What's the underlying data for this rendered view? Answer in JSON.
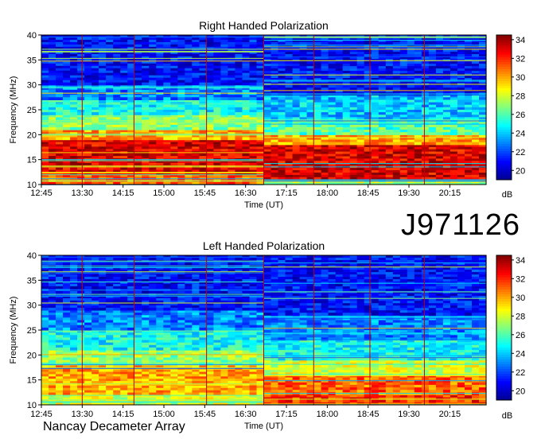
{
  "observatory": "Nancay Decameter Array",
  "observation_id": "J971126",
  "colors": {
    "colormap": [
      "#00008f",
      "#0000ff",
      "#0080ff",
      "#00ffff",
      "#80ff80",
      "#ffff00",
      "#ff8000",
      "#ff0000",
      "#800000"
    ],
    "marker_line": "#c00000"
  },
  "chart_data": [
    {
      "type": "heatmap",
      "title": "Right Handed Polarization",
      "xlabel": "Time (UT)",
      "ylabel": "Frequency (MHz)",
      "x_ticks": [
        "12:45",
        "13:30",
        "14:15",
        "15:00",
        "15:45",
        "16:30",
        "17:15",
        "18:00",
        "18:45",
        "19:30",
        "20:15"
      ],
      "y_ticks": [
        10,
        15,
        20,
        25,
        30,
        35,
        40
      ],
      "ylim": [
        10,
        40
      ],
      "xlim": [
        "12:45",
        "20:55"
      ],
      "colorbar": {
        "label": "dB",
        "ticks": [
          20,
          22,
          24,
          26,
          28,
          30,
          32,
          34
        ],
        "range": [
          19,
          34.5
        ]
      },
      "marker_times": [
        "13:30",
        "14:27",
        "15:47",
        "16:50",
        "17:45",
        "18:47",
        "19:47"
      ],
      "session_break": "16:50",
      "bands_before_break": [
        {
          "from": 10,
          "to": 12,
          "db": 31
        },
        {
          "from": 12,
          "to": 19,
          "db": 33
        },
        {
          "from": 19,
          "to": 21,
          "db": 30
        },
        {
          "from": 21,
          "to": 24,
          "db": 27
        },
        {
          "from": 24,
          "to": 27,
          "db": 25
        },
        {
          "from": 27,
          "to": 30,
          "db": 23
        },
        {
          "from": 30,
          "to": 40,
          "db": 21
        }
      ],
      "bands_after_break": [
        {
          "from": 10,
          "to": 11,
          "db": 28
        },
        {
          "from": 11,
          "to": 18,
          "db": 33
        },
        {
          "from": 18,
          "to": 20,
          "db": 30
        },
        {
          "from": 20,
          "to": 23,
          "db": 26
        },
        {
          "from": 23,
          "to": 28,
          "db": 24
        },
        {
          "from": 28,
          "to": 40,
          "db": 21
        }
      ]
    },
    {
      "type": "heatmap",
      "title": "Left Handed Polarization",
      "xlabel": "Time (UT)",
      "ylabel": "Frequency (MHz)",
      "x_ticks": [
        "12:45",
        "13:30",
        "14:15",
        "15:00",
        "15:45",
        "16:30",
        "17:15",
        "18:00",
        "18:45",
        "19:30",
        "20:15"
      ],
      "y_ticks": [
        10,
        15,
        20,
        25,
        30,
        35,
        40
      ],
      "ylim": [
        10,
        40
      ],
      "xlim": [
        "12:45",
        "20:55"
      ],
      "colorbar": {
        "label": "dB",
        "ticks": [
          20,
          22,
          24,
          26,
          28,
          30,
          32,
          34
        ],
        "range": [
          19,
          34.5
        ]
      },
      "marker_times": [
        "13:30",
        "14:27",
        "15:47",
        "16:50",
        "17:45",
        "18:47",
        "19:47"
      ],
      "session_break": "16:50",
      "bands_before_break": [
        {
          "from": 10,
          "to": 12,
          "db": 28
        },
        {
          "from": 12,
          "to": 18,
          "db": 30
        },
        {
          "from": 18,
          "to": 21,
          "db": 27
        },
        {
          "from": 21,
          "to": 25,
          "db": 25
        },
        {
          "from": 25,
          "to": 29,
          "db": 23
        },
        {
          "from": 29,
          "to": 40,
          "db": 21
        }
      ],
      "bands_after_break": [
        {
          "from": 10,
          "to": 12,
          "db": 32
        },
        {
          "from": 12,
          "to": 16,
          "db": 31
        },
        {
          "from": 16,
          "to": 19,
          "db": 28
        },
        {
          "from": 19,
          "to": 23,
          "db": 25
        },
        {
          "from": 23,
          "to": 28,
          "db": 23
        },
        {
          "from": 28,
          "to": 40,
          "db": 21
        }
      ]
    }
  ]
}
